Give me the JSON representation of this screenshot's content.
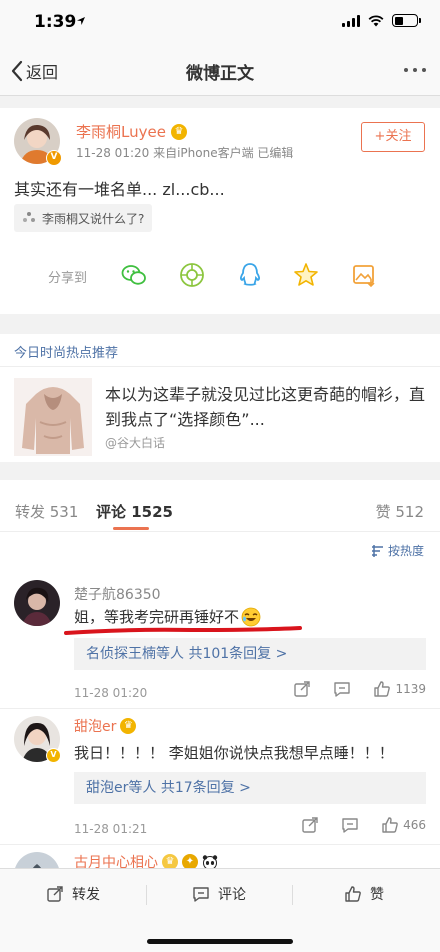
{
  "status_bar": {
    "time": "1:39"
  },
  "nav": {
    "back_label": "返回",
    "title": "微博正文"
  },
  "post": {
    "author": "李雨桐Luyee",
    "meta": "11-28 01:20  来自iPhone客户端  已编辑",
    "follow_label": "+关注",
    "text": "其实还有一堆名单... zl...cb...",
    "topic": "李雨桐又说什么了?",
    "share_label": "分享到"
  },
  "hot": {
    "header": "今日时尚热点推荐",
    "title": "本以为这辈子就没见过比这更奇葩的帽衫，直到我点了“选择颜色”...",
    "source": "@谷大白话"
  },
  "tabs": {
    "repost": "转发 531",
    "comment": "评论 1525",
    "like": "赞 512"
  },
  "sort_label": "按热度",
  "comments": [
    {
      "name": "楚子航86350",
      "text": "姐，等我考完研再锤好不",
      "replies": "名侦探王楠等人  共101条回复 >",
      "time": "11-28 01:20",
      "likes": "1139"
    },
    {
      "name": "甜泡er",
      "text": "我日！！！！ 李姐姐你说快点我想早点睡！！！",
      "replies": "甜泡er等人  共17条回复 >",
      "time": "11-28 01:21",
      "likes": "466"
    },
    {
      "name": "古月中心相心"
    }
  ],
  "bottom_bar": {
    "repost": "转发",
    "comment": "评论",
    "like": "赞"
  },
  "colors": {
    "accent": "#eb7350",
    "link": "#4e72a6",
    "underline": "#d9141c"
  }
}
